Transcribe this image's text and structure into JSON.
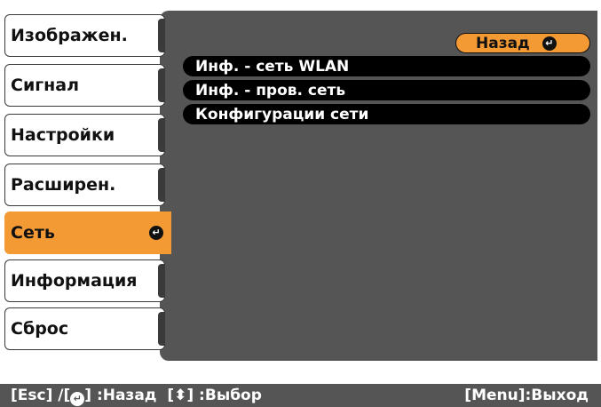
{
  "sidebar": {
    "items": [
      {
        "label": "Изображен."
      },
      {
        "label": "Сигнал"
      },
      {
        "label": "Настройки"
      },
      {
        "label": "Расширен."
      },
      {
        "label": "Сеть",
        "active": true
      },
      {
        "label": "Информация"
      },
      {
        "label": "Сброс"
      }
    ]
  },
  "main": {
    "back_label": "Назад",
    "items": [
      {
        "label": "Инф. - сеть WLAN"
      },
      {
        "label": "Инф. - пров. сеть"
      },
      {
        "label": "Конфигурации сети"
      }
    ]
  },
  "footer": {
    "esc_part1": "[Esc] /[",
    "esc_part2": "] :Назад",
    "select_hint": "[⬍] :Выбор",
    "menu_hint": "[Menu]:Выход"
  },
  "colors": {
    "accent": "#f39a35",
    "panel": "#555555"
  },
  "icons": {
    "enter": "enter-icon"
  }
}
